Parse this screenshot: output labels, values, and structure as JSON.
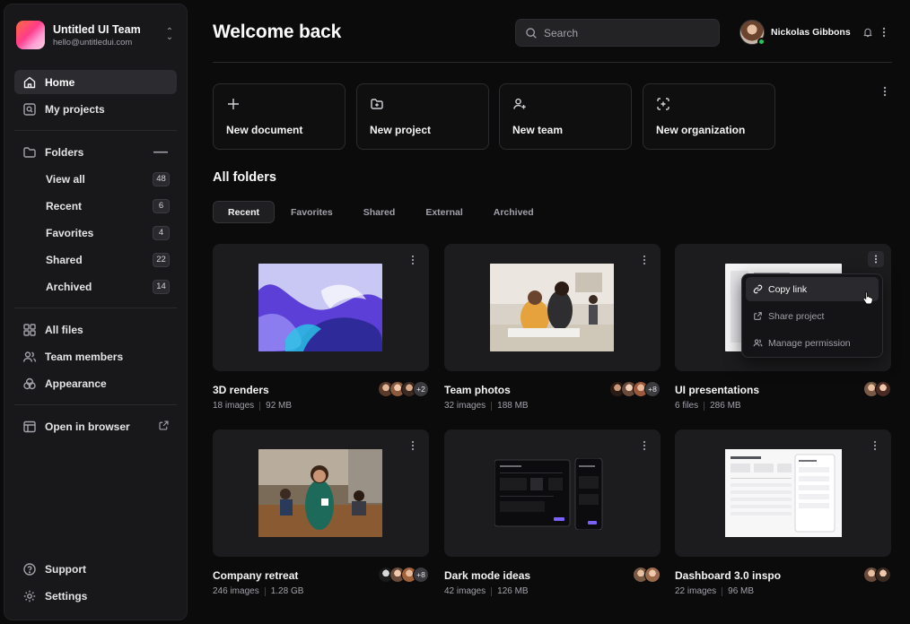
{
  "team": {
    "name": "Untitled UI Team",
    "email": "hello@untitledui.com"
  },
  "nav": {
    "home": "Home",
    "my_projects": "My projects",
    "folders": "Folders",
    "folder_items": [
      {
        "label": "View all",
        "count": "48"
      },
      {
        "label": "Recent",
        "count": "6"
      },
      {
        "label": "Favorites",
        "count": "4"
      },
      {
        "label": "Shared",
        "count": "22"
      },
      {
        "label": "Archived",
        "count": "14"
      }
    ],
    "all_files": "All files",
    "team_members": "Team members",
    "appearance": "Appearance",
    "open_in_browser": "Open in browser",
    "support": "Support",
    "settings": "Settings"
  },
  "header": {
    "title": "Welcome back",
    "search_placeholder": "Search",
    "user_name": "Nickolas Gibbons"
  },
  "quick_actions": [
    "New document",
    "New project",
    "New team",
    "New organization"
  ],
  "folders": {
    "title": "All folders",
    "tabs": [
      "Recent",
      "Favorites",
      "Shared",
      "External",
      "Archived"
    ],
    "cards": [
      {
        "title": "3D renders",
        "files": "18 images",
        "size": "92 MB",
        "more": "+2"
      },
      {
        "title": "Team photos",
        "files": "32 images",
        "size": "188 MB",
        "more": "+8"
      },
      {
        "title": "UI presentations",
        "files": "6 files",
        "size": "286 MB",
        "more": ""
      },
      {
        "title": "Company retreat",
        "files": "246 images",
        "size": "1.28 GB",
        "more": "+8"
      },
      {
        "title": "Dark mode ideas",
        "files": "42 images",
        "size": "126 MB",
        "more": ""
      },
      {
        "title": "Dashboard 3.0 inspo",
        "files": "22 images",
        "size": "96 MB",
        "more": ""
      }
    ]
  },
  "context_menu": [
    "Copy link",
    "Share project",
    "Manage permission"
  ],
  "colors": {
    "background": "#0b0b0c",
    "sidebar": "#18181a",
    "card": "#1c1c1e",
    "online": "#22c55e"
  }
}
